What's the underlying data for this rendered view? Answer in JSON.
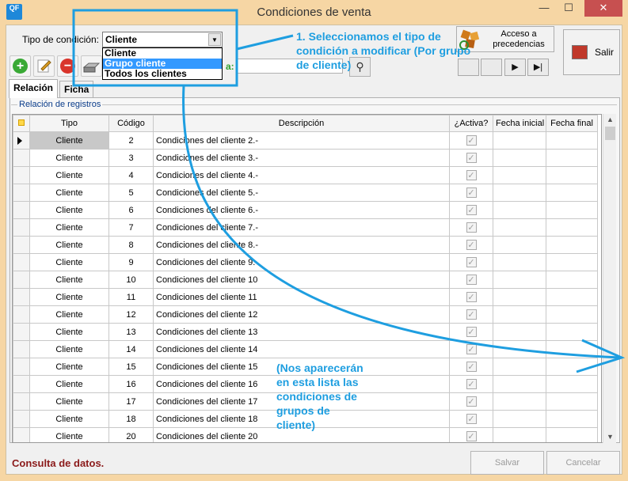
{
  "window": {
    "title": "Condiciones de venta",
    "app_icon": "QF",
    "minimize": "—",
    "maximize": "☐",
    "close": "✕"
  },
  "filter": {
    "label": "Tipo de condición:",
    "selected": "Cliente",
    "options": [
      "Cliente",
      "Grupo cliente",
      "Todos los clientes"
    ],
    "highlighted_option": "Grupo cliente",
    "search_label_fragment": "a:"
  },
  "toolbar": {
    "prec_label_1": "Acceso a",
    "prec_label_2": "precedencias",
    "salir_label": "Salir"
  },
  "tabs": [
    {
      "label": "Relación",
      "active": true
    },
    {
      "label": "Ficha",
      "active": false
    }
  ],
  "group_title": "Relación de registros",
  "table": {
    "columns": [
      "Tipo",
      "Código",
      "Descripción",
      "¿Activa?",
      "Fecha inicial",
      "Fecha final"
    ],
    "rows": [
      {
        "tipo": "Cliente",
        "codigo": "2",
        "descripcion": "Condiciones del cliente 2.-",
        "activa": true
      },
      {
        "tipo": "Cliente",
        "codigo": "3",
        "descripcion": "Condiciones del cliente 3.-",
        "activa": true
      },
      {
        "tipo": "Cliente",
        "codigo": "4",
        "descripcion": "Condiciones del cliente 4.-",
        "activa": true
      },
      {
        "tipo": "Cliente",
        "codigo": "5",
        "descripcion": "Condiciones del cliente 5.-",
        "activa": true
      },
      {
        "tipo": "Cliente",
        "codigo": "6",
        "descripcion": "Condiciones del cliente 6.-",
        "activa": true
      },
      {
        "tipo": "Cliente",
        "codigo": "7",
        "descripcion": "Condiciones del cliente 7.-",
        "activa": true
      },
      {
        "tipo": "Cliente",
        "codigo": "8",
        "descripcion": "Condiciones del cliente 8.-",
        "activa": true
      },
      {
        "tipo": "Cliente",
        "codigo": "9",
        "descripcion": "Condiciones del cliente 9.-",
        "activa": true
      },
      {
        "tipo": "Cliente",
        "codigo": "10",
        "descripcion": "Condiciones del cliente 10",
        "activa": true
      },
      {
        "tipo": "Cliente",
        "codigo": "11",
        "descripcion": "Condiciones del cliente 11",
        "activa": true
      },
      {
        "tipo": "Cliente",
        "codigo": "12",
        "descripcion": "Condiciones del cliente 12",
        "activa": true
      },
      {
        "tipo": "Cliente",
        "codigo": "13",
        "descripcion": "Condiciones del cliente 13",
        "activa": true
      },
      {
        "tipo": "Cliente",
        "codigo": "14",
        "descripcion": "Condiciones del cliente 14",
        "activa": true
      },
      {
        "tipo": "Cliente",
        "codigo": "15",
        "descripcion": "Condiciones del cliente 15",
        "activa": true
      },
      {
        "tipo": "Cliente",
        "codigo": "16",
        "descripcion": "Condiciones del cliente 16",
        "activa": true
      },
      {
        "tipo": "Cliente",
        "codigo": "17",
        "descripcion": "Condiciones del cliente 17",
        "activa": true
      },
      {
        "tipo": "Cliente",
        "codigo": "18",
        "descripcion": "Condiciones del cliente 18",
        "activa": true
      },
      {
        "tipo": "Cliente",
        "codigo": "20",
        "descripcion": "Condiciones del cliente 20",
        "activa": true
      }
    ]
  },
  "status": {
    "text": "Consulta de datos.",
    "save_label": "Salvar",
    "cancel_label": "Cancelar"
  },
  "annotations": {
    "step1_line1": "1. Seleccionamos el tipo de",
    "step1_line2": "condición a modificar (Por grupo",
    "step1_line3": "de cliente)",
    "note_line1": "(Nos aparecerán",
    "note_line2": "en esta lista las",
    "note_line3": "condiciones de",
    "note_line4": "grupos de",
    "note_line5": "cliente)",
    "color": "#1e9ee0"
  }
}
